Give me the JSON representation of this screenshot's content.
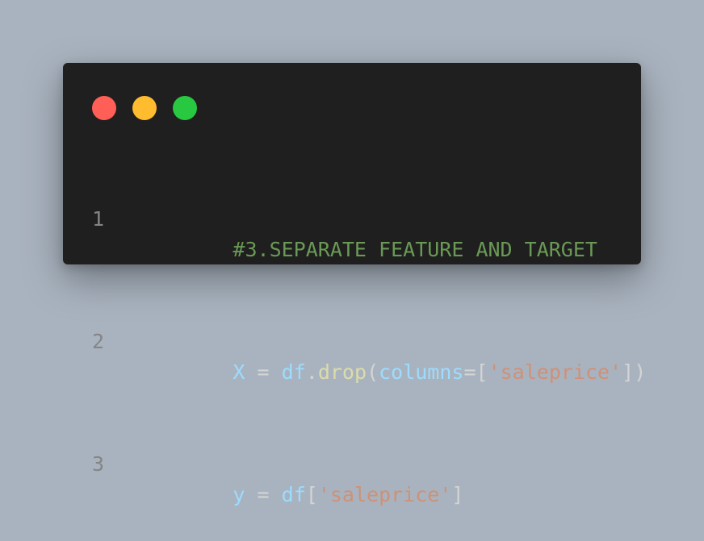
{
  "window": {
    "controls": [
      {
        "name": "close",
        "color": "#ff5f57"
      },
      {
        "name": "minimize",
        "color": "#febc2e"
      },
      {
        "name": "maximize",
        "color": "#28c840"
      }
    ]
  },
  "code": {
    "lines": [
      {
        "number": "1",
        "tokens": [
          {
            "text": "#3.SEPARATE FEATURE AND TARGET",
            "type": "comment"
          }
        ]
      },
      {
        "number": "2",
        "tokens": [
          {
            "text": "X",
            "type": "var"
          },
          {
            "text": " = ",
            "type": "op"
          },
          {
            "text": "df",
            "type": "var"
          },
          {
            "text": ".",
            "type": "op"
          },
          {
            "text": "drop",
            "type": "fn"
          },
          {
            "text": "(",
            "type": "op"
          },
          {
            "text": "columns",
            "type": "var"
          },
          {
            "text": "=[",
            "type": "op"
          },
          {
            "text": "'saleprice'",
            "type": "str"
          },
          {
            "text": "])",
            "type": "op"
          }
        ]
      },
      {
        "number": "3",
        "tokens": [
          {
            "text": "y",
            "type": "var"
          },
          {
            "text": " = ",
            "type": "op"
          },
          {
            "text": "df",
            "type": "var"
          },
          {
            "text": "[",
            "type": "op"
          },
          {
            "text": "'saleprice'",
            "type": "str"
          },
          {
            "text": "]",
            "type": "op"
          }
        ]
      }
    ]
  }
}
